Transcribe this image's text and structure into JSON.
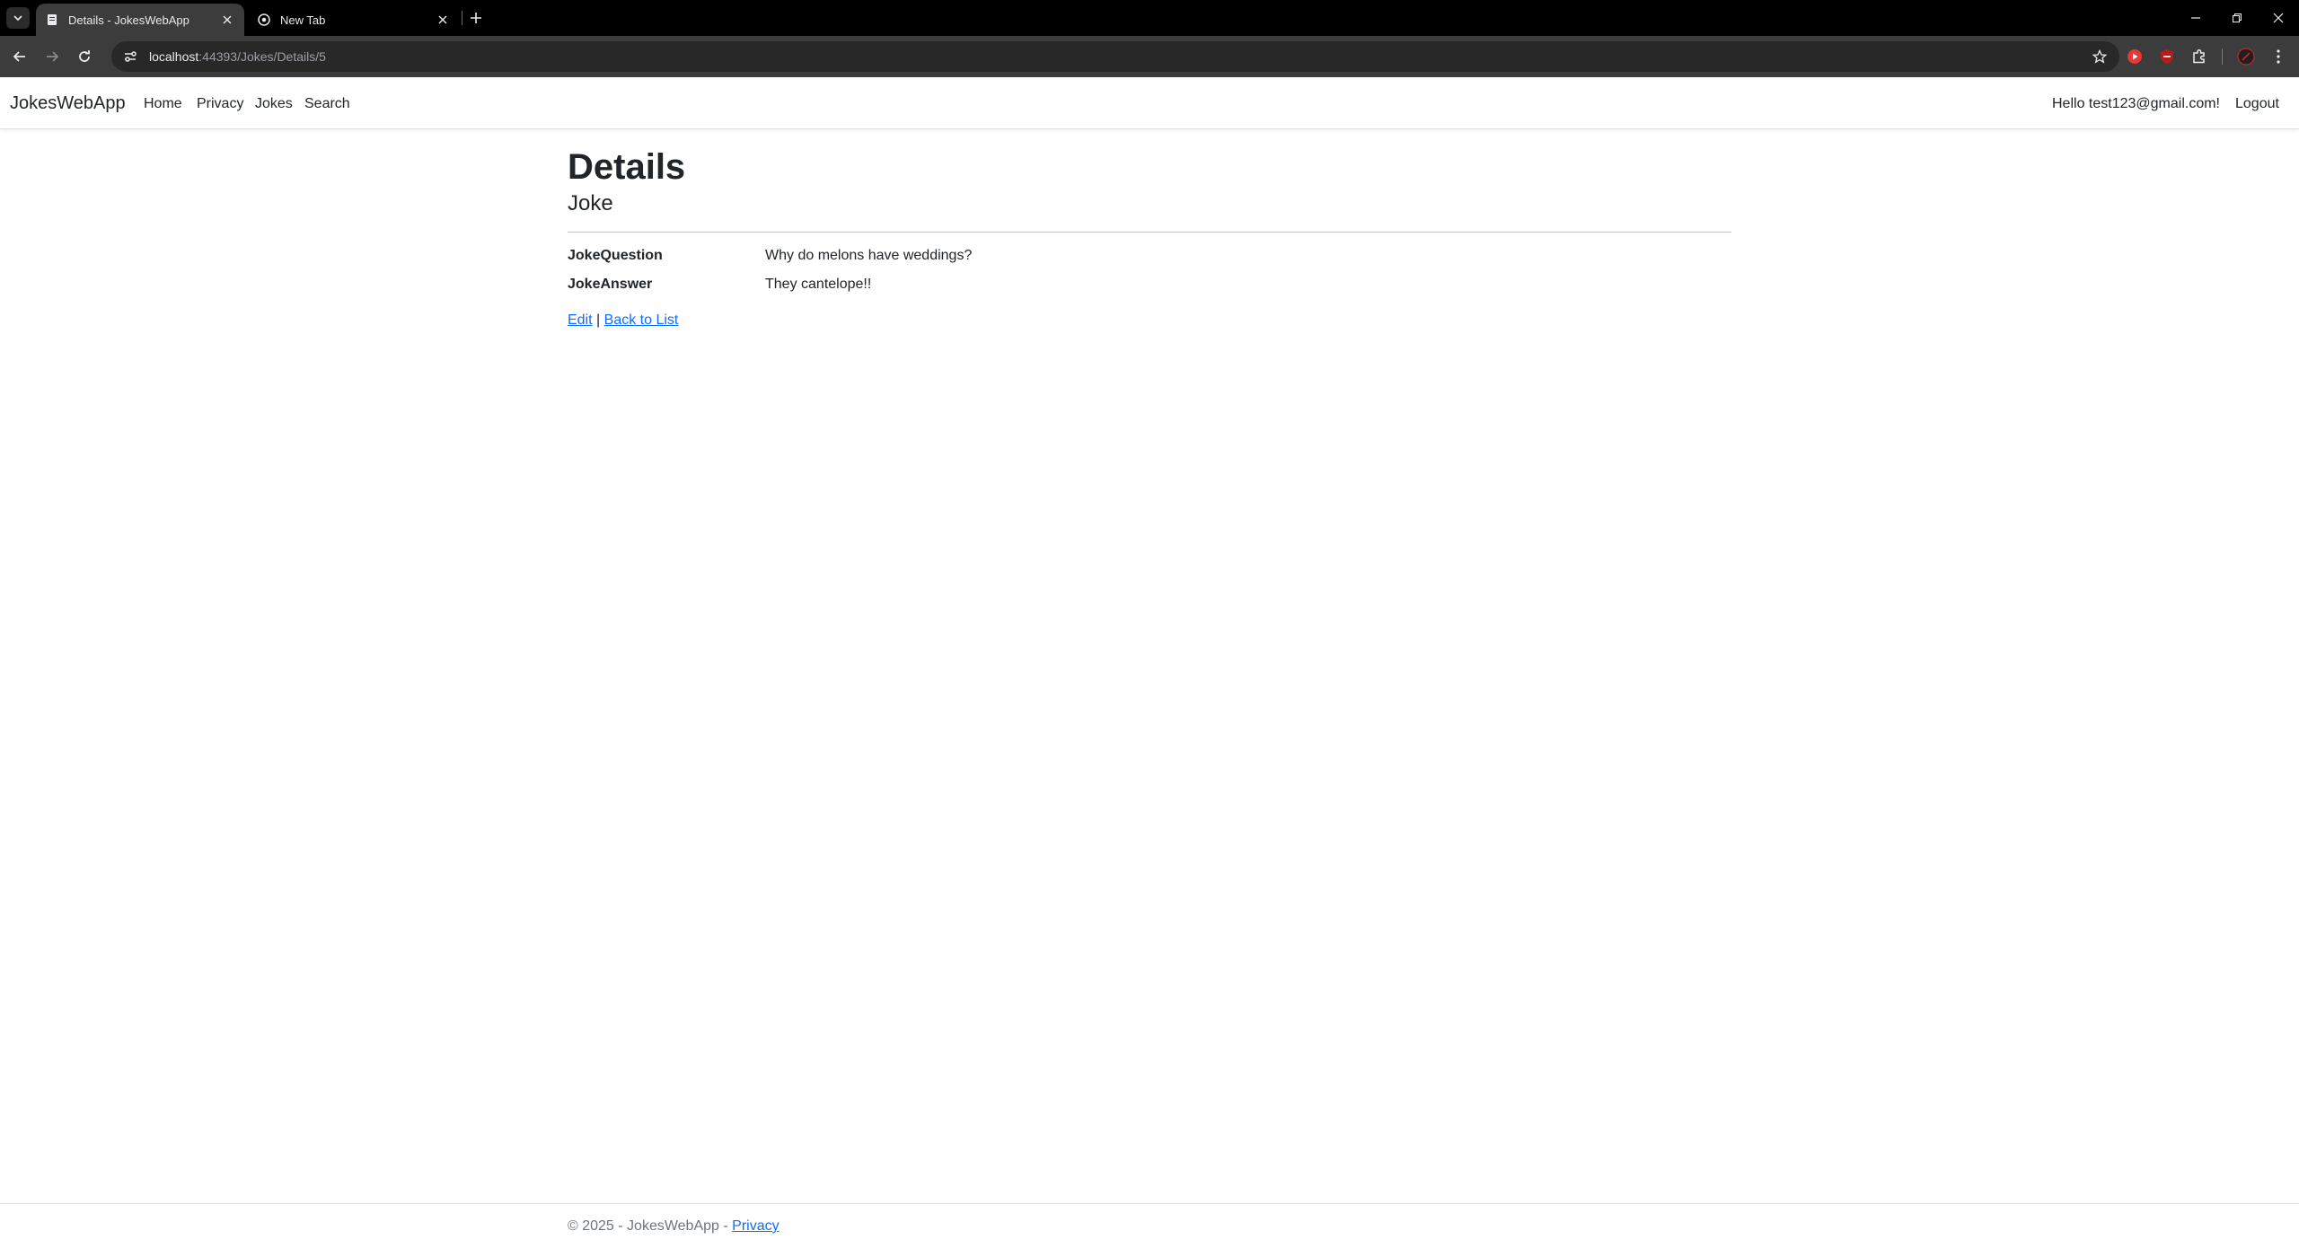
{
  "browser": {
    "tabs": [
      {
        "title": "Details - JokesWebApp",
        "active": true
      },
      {
        "title": "New Tab",
        "active": false
      }
    ],
    "address": {
      "host": "localhost",
      "path": ":44393/Jokes/Details/5"
    }
  },
  "site": {
    "brand": "JokesWebApp",
    "nav": [
      "Home",
      "Privacy",
      "Jokes",
      "Search"
    ],
    "greeting": "Hello test123@gmail.com!",
    "logout": "Logout"
  },
  "page": {
    "title": "Details",
    "subtitle": "Joke",
    "fields": [
      {
        "label": "JokeQuestion",
        "value": "Why do melons have weddings?"
      },
      {
        "label": "JokeAnswer",
        "value": "They cantelope!!"
      }
    ],
    "edit_link": "Edit",
    "separator": "|",
    "back_link": "Back to List"
  },
  "footer": {
    "text": "© 2025 - JokesWebApp - ",
    "privacy_link": "Privacy"
  },
  "colors": {
    "link": "#0d6efd",
    "text": "#212529",
    "muted": "#6c757d",
    "chrome_dark": "#000000",
    "chrome_toolbar": "#3c3c3c"
  }
}
